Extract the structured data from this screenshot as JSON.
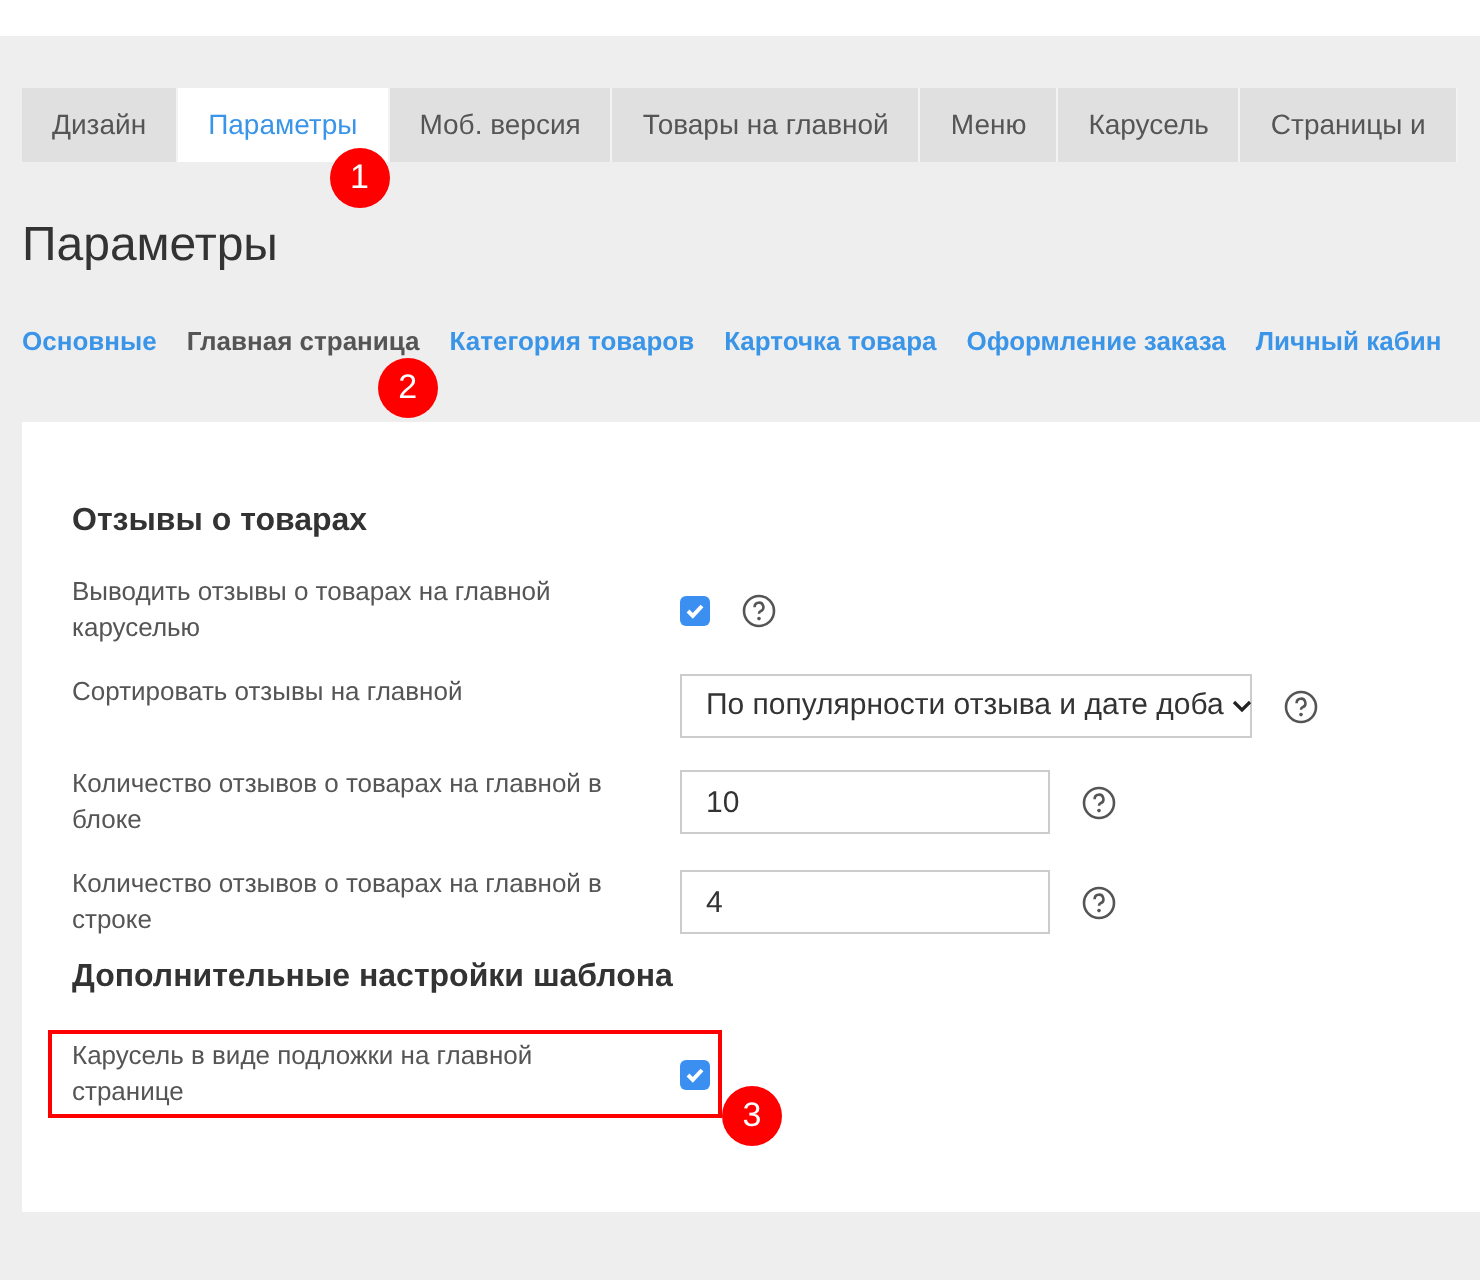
{
  "tabs": [
    {
      "label": "Дизайн",
      "selected": false
    },
    {
      "label": "Параметры",
      "selected": true,
      "badge": "1"
    },
    {
      "label": "Моб. версия",
      "selected": false
    },
    {
      "label": "Товары на главной",
      "selected": false
    },
    {
      "label": "Меню",
      "selected": false
    },
    {
      "label": "Карусель",
      "selected": false
    },
    {
      "label": "Страницы и",
      "selected": false
    }
  ],
  "page_title": "Параметры",
  "subtabs": [
    {
      "label": "Основные",
      "selected": false
    },
    {
      "label": "Главная страница",
      "selected": true,
      "badge": "2"
    },
    {
      "label": "Категория товаров",
      "selected": false
    },
    {
      "label": "Карточка товара",
      "selected": false
    },
    {
      "label": "Оформление заказа",
      "selected": false
    },
    {
      "label": "Личный кабин",
      "selected": false
    }
  ],
  "sections": [
    {
      "title": "Отзывы о товарах",
      "rows": [
        {
          "kind": "checkbox",
          "label": "Выводить отзывы о товарах на главной каруселью",
          "checked": true,
          "help": true,
          "highlighted": false
        },
        {
          "kind": "select",
          "label": "Сортировать отзывы на главной",
          "value": "По популярности отзыва и дате доба",
          "help": true,
          "highlighted": false
        },
        {
          "kind": "input",
          "label": "Количество отзывов о товарах на главной в блоке",
          "value": "10",
          "help": true,
          "highlighted": false
        },
        {
          "kind": "input",
          "label": "Количество отзывов о товарах на главной в строке",
          "value": "4",
          "help": true,
          "highlighted": false
        }
      ]
    },
    {
      "title": "Дополнительные настройки шаблона",
      "rows": [
        {
          "kind": "checkbox",
          "label": "Карусель в виде подложки на главной странице",
          "checked": true,
          "help": false,
          "highlighted": true,
          "badge": "3"
        }
      ]
    }
  ]
}
